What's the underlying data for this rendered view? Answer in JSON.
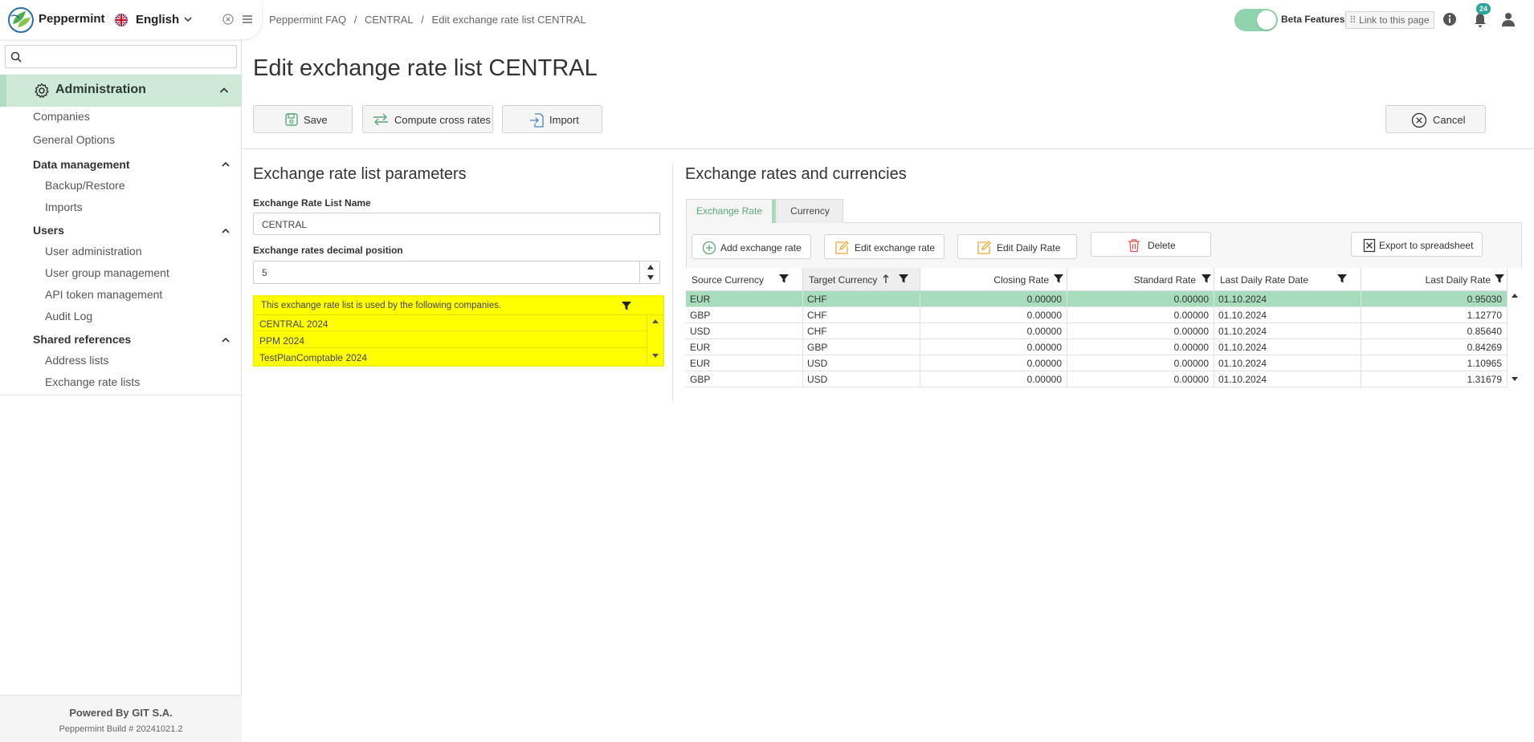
{
  "sidebar": {
    "brand": "Peppermint",
    "language": "English",
    "search_placeholder": "",
    "section": "Administration",
    "items": {
      "companies": "Companies",
      "general_options": "General Options",
      "data_management": "Data management",
      "backup_restore": "Backup/Restore",
      "imports": "Imports",
      "users": "Users",
      "user_administration": "User administration",
      "user_group_management": "User group management",
      "api_token_management": "API token management",
      "audit_log": "Audit Log",
      "shared_references": "Shared references",
      "address_lists": "Address lists",
      "exchange_rate_lists": "Exchange rate lists"
    },
    "footer_powered": "Powered By GIT S.A.",
    "footer_build": "Peppermint Build # 20241021.2"
  },
  "header": {
    "breadcrumb": [
      "Peppermint FAQ",
      "/",
      "CENTRAL",
      "/",
      "Edit exchange rate list CENTRAL"
    ],
    "beta_label": "Beta Features",
    "link_label": "Link to this page",
    "notification_count": "24"
  },
  "page_title": "Edit exchange rate list CENTRAL",
  "toolbar": {
    "save": "Save",
    "compute": "Compute cross rates",
    "import": "Import",
    "cancel": "Cancel"
  },
  "params": {
    "title": "Exchange rate list parameters",
    "name_label": "Exchange Rate List Name",
    "name_value": "CENTRAL",
    "decimal_label": "Exchange rates decimal position",
    "decimal_value": "5",
    "companies_header": "This exchange rate list is used by the following companies.",
    "companies": [
      "CENTRAL 2024",
      "PPM 2024",
      "TestPlanComptable 2024"
    ]
  },
  "rates": {
    "title": "Exchange rates and currencies",
    "tabs": {
      "rate": "Exchange Rate",
      "currency": "Currency"
    },
    "buttons": {
      "add": "Add exchange rate",
      "edit": "Edit exchange rate",
      "edit_daily": "Edit Daily Rate",
      "delete": "Delete",
      "export": "Export to spreadsheet"
    },
    "columns": [
      "Source Currency",
      "Target Currency",
      "Closing Rate",
      "Standard Rate",
      "Last Daily Rate Date",
      "Last Daily Rate"
    ],
    "rows": [
      [
        "EUR",
        "CHF",
        "0.00000",
        "0.00000",
        "01.10.2024",
        "0.95030"
      ],
      [
        "GBP",
        "CHF",
        "0.00000",
        "0.00000",
        "01.10.2024",
        "1.12770"
      ],
      [
        "USD",
        "CHF",
        "0.00000",
        "0.00000",
        "01.10.2024",
        "0.85640"
      ],
      [
        "EUR",
        "GBP",
        "0.00000",
        "0.00000",
        "01.10.2024",
        "0.84269"
      ],
      [
        "EUR",
        "USD",
        "0.00000",
        "0.00000",
        "01.10.2024",
        "1.10965"
      ],
      [
        "GBP",
        "USD",
        "0.00000",
        "0.00000",
        "01.10.2024",
        "1.31679"
      ]
    ]
  },
  "colors": {
    "accent": "#26a69a",
    "selected_row": "#a7dcbd",
    "sidebar_active": "#cfe9d8",
    "highlight": "#ffff00"
  }
}
